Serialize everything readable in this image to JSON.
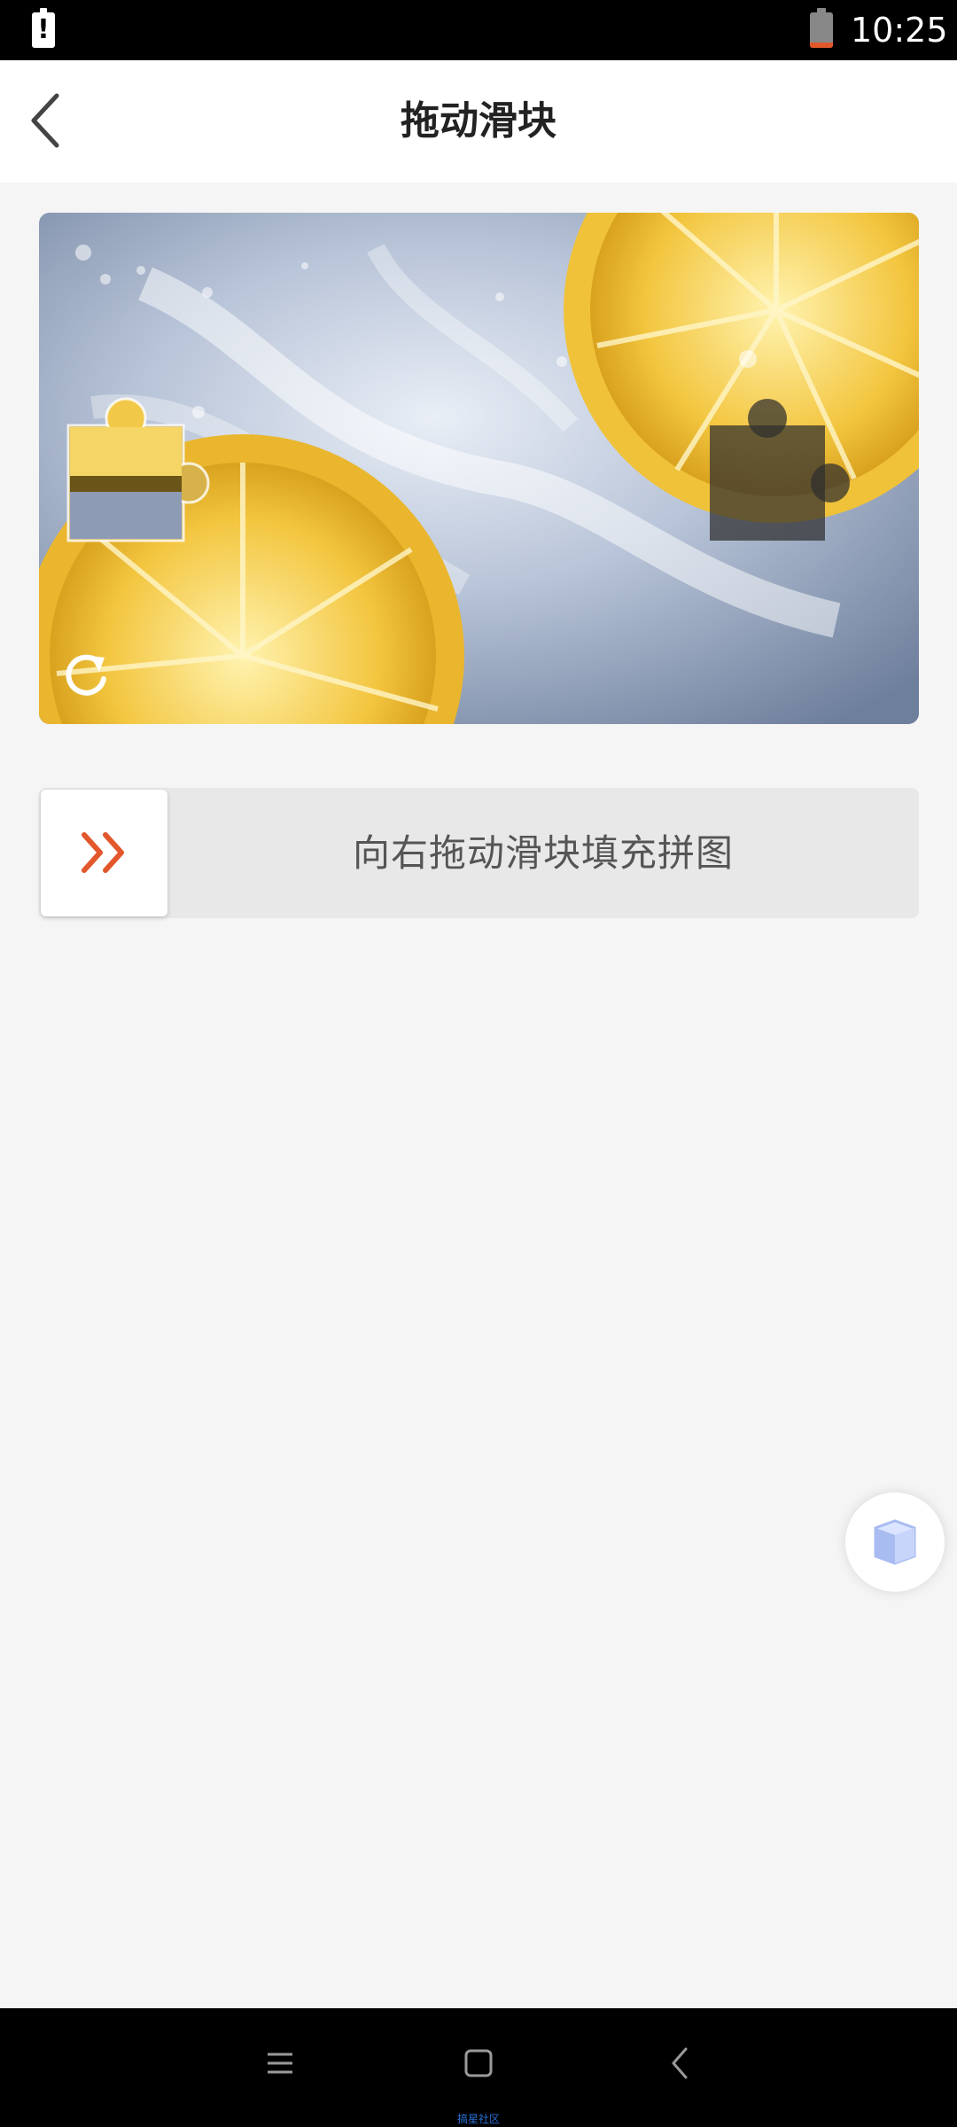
{
  "status_bar": {
    "alert_glyph": "!",
    "time": "10:25",
    "icons": [
      "alert-icon",
      "battery-icon"
    ]
  },
  "app_bar": {
    "title": "拖动滑块",
    "back_icon": "chevron-left-icon"
  },
  "captcha": {
    "image_description_icon": "lemon-water-photo",
    "refresh_icon": "refresh-icon",
    "slider_progress": 0,
    "slider_hint": "向右拖动滑块填充拼图",
    "handle_icon": "double-chevron-right-icon"
  },
  "floating_button": {
    "icon": "cube-icon"
  },
  "nav_bar": {
    "icons": [
      "menu-icon",
      "home-icon",
      "back-icon"
    ],
    "watermark": "搞星社区"
  },
  "colors": {
    "accent": "#e2572b",
    "track": "#e8e8e8",
    "background": "#f5f5f5"
  }
}
